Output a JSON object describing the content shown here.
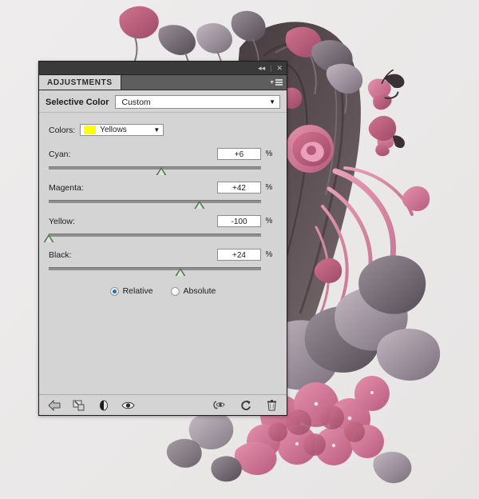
{
  "window": {
    "titlebar": {
      "collapse_icon": "collapse-double-arrow-icon",
      "close_icon": "close-icon",
      "separator": "|"
    },
    "tab": {
      "label": "ADJUSTMENTS",
      "menu_icon": "panel-menu-icon"
    }
  },
  "header": {
    "adjustment_name": "Selective Color",
    "preset": {
      "value": "Custom",
      "caret": "▼"
    }
  },
  "colors": {
    "label": "Colors:",
    "selected": "Yellows",
    "swatch_color": "#ffff00",
    "caret": "▼"
  },
  "sliders": [
    {
      "name": "Cyan:",
      "value": "+6",
      "unit": "%",
      "percent": 53.0
    },
    {
      "name": "Magenta:",
      "value": "+42",
      "unit": "%",
      "percent": 71.0
    },
    {
      "name": "Yellow:",
      "value": "-100",
      "unit": "%",
      "percent": 0.0
    },
    {
      "name": "Black:",
      "value": "+24",
      "unit": "%",
      "percent": 62.0
    }
  ],
  "method": {
    "options": [
      {
        "label": "Relative",
        "selected": true
      },
      {
        "label": "Absolute",
        "selected": false
      }
    ]
  },
  "footer": {
    "left_icons": [
      "return-to-adjustment-list-icon",
      "clip-to-layer-icon",
      "toggle-layer-mask-icon",
      "toggle-layer-visibility-icon"
    ],
    "right_icons": [
      "view-previous-state-icon",
      "reset-adjustment-icon",
      "delete-adjustment-layer-icon"
    ]
  },
  "artwork": {
    "description": "digital-art-portrait-with-roses-butterflies-and-hydrangeas",
    "background_color": "#edebea"
  }
}
